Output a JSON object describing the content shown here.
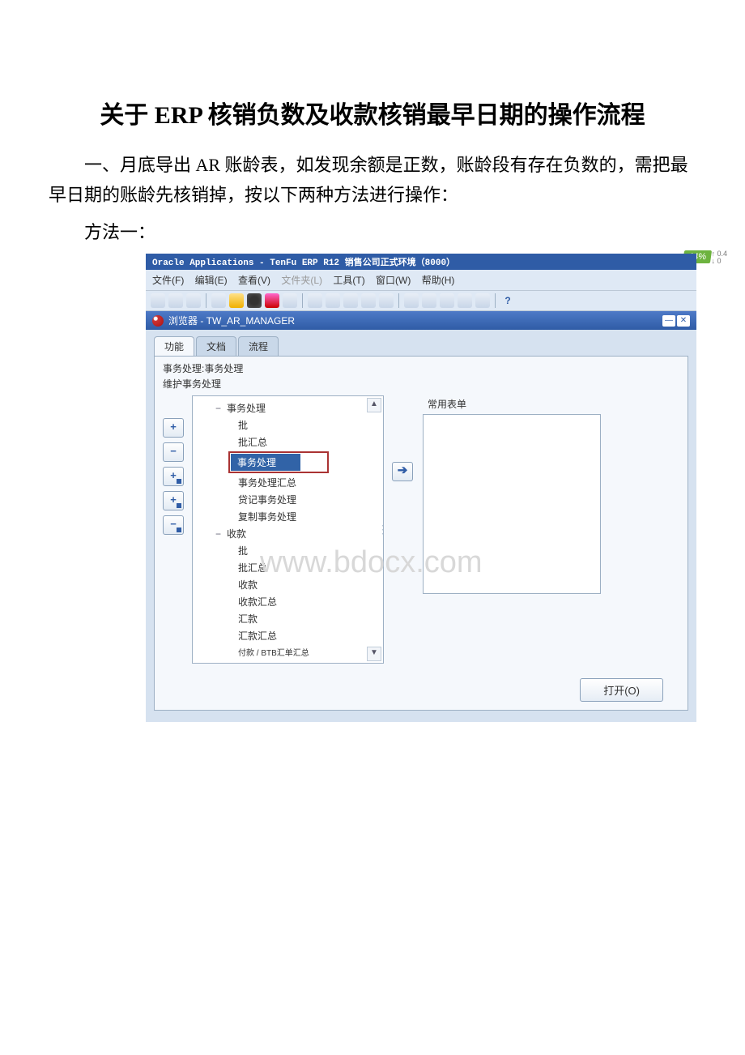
{
  "doc": {
    "title": "关于 ERP 核销负数及收款核销最早日期的操作流程",
    "para1": "一、月底导出 AR 账龄表，如发现余额是正数，账龄段有存在负数的，需把最早日期的账龄先核销掉，按以下两种方法进行操作：",
    "para2": "方法一："
  },
  "app": {
    "titlebar": "Oracle Applications - TenFu ERP R12 销售公司正式环境（8000）",
    "quality_badge": "44%",
    "quality_up": "0.4",
    "quality_down": "0",
    "menu": {
      "file": "文件(F)",
      "edit": "编辑(E)",
      "view": "查看(V)",
      "folder": "文件夹(L)",
      "tools": "工具(T)",
      "window": "窗口(W)",
      "help": "帮助(H)"
    },
    "toolbar_help": "?",
    "browser_title": "浏览器 - TW_AR_MANAGER",
    "tabs": {
      "t1": "功能",
      "t2": "文档",
      "t3": "流程"
    },
    "breadcrumb1": "事务处理:事务处理",
    "breadcrumb2": "维护事务处理",
    "tree": {
      "n1": "事务处理",
      "n1a": "批",
      "n1b": "批汇总",
      "n1c": "事务处理",
      "n1d": "事务处理汇总",
      "n1e": "贷记事务处理",
      "n1f": "复制事务处理",
      "n2": "收款",
      "n2a": "批",
      "n2b": "批汇总",
      "n2c": "收款",
      "n2d": "收款汇总",
      "n2e": "汇款",
      "n2f": "汇款汇总",
      "n2g": "付款 / BTB汇单汇总"
    },
    "right_header": "常用表单",
    "open_btn": "打开(O)",
    "watermark": "www.bdocx.com"
  }
}
